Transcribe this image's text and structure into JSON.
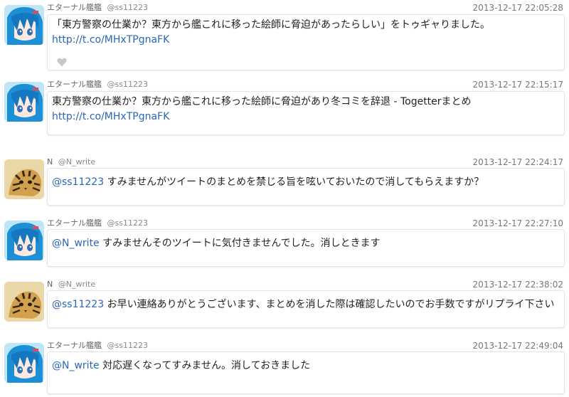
{
  "tweets": [
    {
      "user": {
        "display_name": "エターナル艦艦",
        "screen_name": "@ss11223",
        "avatar": "blue-hair-anime-avatar"
      },
      "timestamp": "2013-12-17 22:05:28",
      "text": "「東方警察の仕業か？東方から艦これに移った絵師に脅迫があったらしい」をトゥギャりました。",
      "link": "http://t.co/MHxTPgnaFK",
      "mention": "",
      "has_favorite_icon": true
    },
    {
      "user": {
        "display_name": "エターナル艦艦",
        "screen_name": "@ss11223",
        "avatar": "blue-hair-anime-avatar"
      },
      "timestamp": "2013-12-17 22:15:17",
      "text": "東方警察の仕業か？東方から艦これに移った絵師に脅迫があり冬コミを辞退 - Togetterまとめ",
      "link": "http://t.co/MHxTPgnaFK",
      "mention": "",
      "has_favorite_icon": false
    },
    {
      "user": {
        "display_name": "N",
        "screen_name": "@N_write",
        "avatar": "tiger-cat-avatar"
      },
      "timestamp": "2013-12-17 22:24:17",
      "mention": "@ss11223",
      "text": "すみませんがツイートのまとめを禁じる旨を呟いておいたので消してもらえますか？",
      "link": "",
      "has_favorite_icon": false
    },
    {
      "user": {
        "display_name": "エターナル艦艦",
        "screen_name": "@ss11223",
        "avatar": "blue-hair-anime-avatar"
      },
      "timestamp": "2013-12-17 22:27:10",
      "mention": "@N_write",
      "text": "すみませんそのツイートに気付きませんでした。消しときます",
      "link": "",
      "has_favorite_icon": false
    },
    {
      "user": {
        "display_name": "N",
        "screen_name": "@N_write",
        "avatar": "tiger-cat-avatar"
      },
      "timestamp": "2013-12-17 22:38:02",
      "mention": "@ss11223",
      "text": "お早い連絡ありがとうございます、まとめを消した際は確認したいのでお手数ですがリプライ下さい",
      "link": "",
      "has_favorite_icon": false
    },
    {
      "user": {
        "display_name": "エターナル艦艦",
        "screen_name": "@ss11223",
        "avatar": "blue-hair-anime-avatar"
      },
      "timestamp": "2013-12-17 22:49:04",
      "mention": "@N_write",
      "text": "対応遅くなってすみません。消しておきました",
      "link": "",
      "has_favorite_icon": false
    }
  ],
  "colors": {
    "link": "#2a66b7",
    "meta": "#777777",
    "border": "#e4e4e4"
  }
}
